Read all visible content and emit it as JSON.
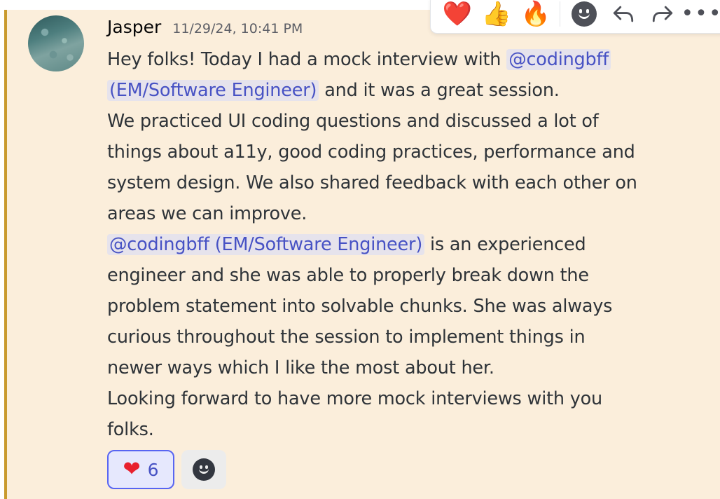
{
  "message": {
    "username": "Jasper",
    "timestamp": "11/29/24, 10:41 PM",
    "lines": [
      [
        {
          "text": "Hey folks! Today I had a mock interview with "
        },
        {
          "mention": "@codingbff"
        }
      ],
      [
        {
          "mention": "(EM/Software Engineer)"
        },
        {
          "text": " and it was a great session."
        }
      ],
      [
        {
          "text": "We practiced UI coding questions and discussed a lot of"
        }
      ],
      [
        {
          "text": "things about a11y, good coding practices, performance and"
        }
      ],
      [
        {
          "text": "system design. We also shared feedback with each other on"
        }
      ],
      [
        {
          "text": "areas we can improve."
        }
      ],
      [
        {
          "mention": "@codingbff (EM/Software Engineer)"
        },
        {
          "text": " is an experienced"
        }
      ],
      [
        {
          "text": "engineer and she was able to properly break down the"
        }
      ],
      [
        {
          "text": "problem statement into solvable chunks. She was always"
        }
      ],
      [
        {
          "text": "curious throughout the session to implement things in"
        }
      ],
      [
        {
          "text": "newer ways which I like the most about her."
        }
      ],
      [
        {
          "text": "Looking forward to have more mock interviews with you"
        }
      ],
      [
        {
          "text": "folks."
        }
      ]
    ]
  },
  "reactions": [
    {
      "emoji": "❤",
      "icon": "heart-icon",
      "count": "6",
      "active": true
    }
  ],
  "add_reaction_icon": "add-reaction-icon",
  "toolbar": {
    "quick_reactions": [
      {
        "emoji": "❤️",
        "icon": "heart-icon"
      },
      {
        "emoji": "👍",
        "icon": "thumbs-up-icon"
      },
      {
        "emoji": "🔥",
        "icon": "fire-icon"
      }
    ],
    "actions": [
      "add-reaction-icon",
      "reply-icon",
      "forward-icon",
      "more-icon"
    ]
  },
  "colors": {
    "background": "#fbeedb",
    "mention_text": "#4752c4",
    "mention_bg": "#e6e3ec",
    "accent_bar": "#c99a2e",
    "reaction_active_border": "#5865f2"
  }
}
